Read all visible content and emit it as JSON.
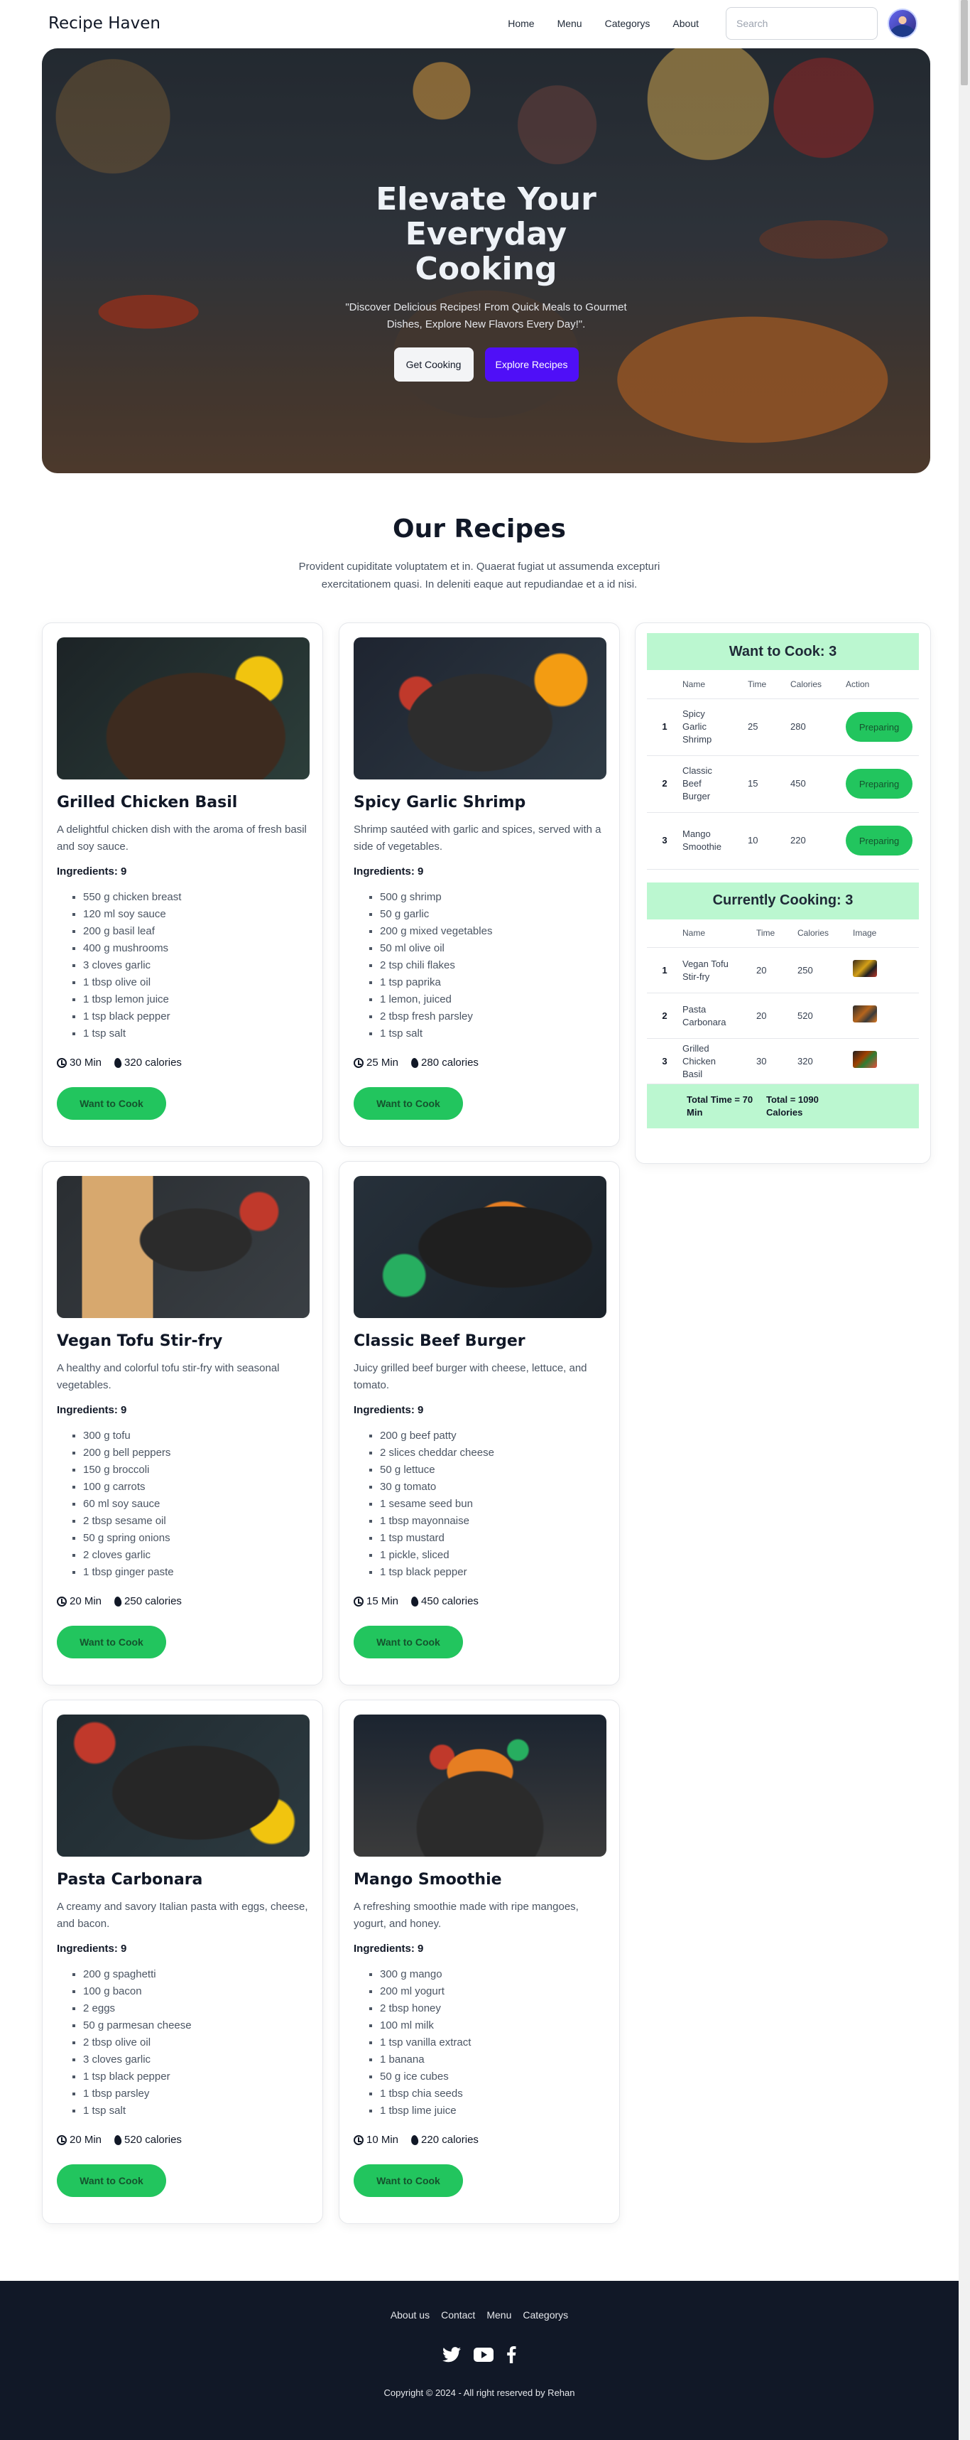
{
  "brand": "Recipe Haven",
  "nav": {
    "links": [
      "Home",
      "Menu",
      "Categorys",
      "About"
    ],
    "search_placeholder": "Search"
  },
  "hero": {
    "title": "Elevate Your Everyday Cooking",
    "subtitle": "\"Discover Delicious Recipes! From Quick Meals to Gourmet Dishes, Explore New Flavors Every Day!\".",
    "btn_get": "Get Cooking",
    "btn_explore": "Explore Recipes"
  },
  "section": {
    "title": "Our Recipes",
    "desc": "Provident cupiditate voluptatem et in. Quaerat fugiat ut assumenda excepturi exercitationem quasi. In deleniti eaque aut repudiandae et a id nisi."
  },
  "recipes": [
    {
      "title": "Grilled Chicken Basil",
      "desc": "A delightful chicken dish with the aroma of fresh basil and soy sauce.",
      "ing_label": "Ingredients: 9",
      "ingredients": [
        "550 g chicken breast",
        "120 ml soy sauce",
        "200 g basil leaf",
        "400 g mushrooms",
        "3 cloves garlic",
        "1 tbsp olive oil",
        "1 tbsp lemon juice",
        "1 tsp black pepper",
        "1 tsp salt"
      ],
      "time": "30 Min",
      "calories": "320 calories",
      "btn": "Want to Cook"
    },
    {
      "title": "Spicy Garlic Shrimp",
      "desc": "Shrimp sautéed with garlic and spices, served with a side of vegetables.",
      "ing_label": "Ingredients: 9",
      "ingredients": [
        "500 g shrimp",
        "50 g garlic",
        "200 g mixed vegetables",
        "50 ml olive oil",
        "2 tsp chili flakes",
        "1 tsp paprika",
        "1 lemon, juiced",
        "2 tbsp fresh parsley",
        "1 tsp salt"
      ],
      "time": "25 Min",
      "calories": "280 calories",
      "btn": "Want to Cook"
    },
    {
      "title": "Vegan Tofu Stir-fry",
      "desc": "A healthy and colorful tofu stir-fry with seasonal vegetables.",
      "ing_label": "Ingredients: 9",
      "ingredients": [
        "300 g tofu",
        "200 g bell peppers",
        "150 g broccoli",
        "100 g carrots",
        "60 ml soy sauce",
        "2 tbsp sesame oil",
        "50 g spring onions",
        "2 cloves garlic",
        "1 tbsp ginger paste"
      ],
      "time": "20 Min",
      "calories": "250 calories",
      "btn": "Want to Cook"
    },
    {
      "title": "Classic Beef Burger",
      "desc": "Juicy grilled beef burger with cheese, lettuce, and tomato.",
      "ing_label": "Ingredients: 9",
      "ingredients": [
        "200 g beef patty",
        "2 slices cheddar cheese",
        "50 g lettuce",
        "30 g tomato",
        "1 sesame seed bun",
        "1 tbsp mayonnaise",
        "1 tsp mustard",
        "1 pickle, sliced",
        "1 tsp black pepper"
      ],
      "time": "15 Min",
      "calories": "450 calories",
      "btn": "Want to Cook"
    },
    {
      "title": "Pasta Carbonara",
      "desc": "A creamy and savory Italian pasta with eggs, cheese, and bacon.",
      "ing_label": "Ingredients: 9",
      "ingredients": [
        "200 g spaghetti",
        "100 g bacon",
        "2 eggs",
        "50 g parmesan cheese",
        "2 tbsp olive oil",
        "3 cloves garlic",
        "1 tsp black pepper",
        "1 tbsp parsley",
        "1 tsp salt"
      ],
      "time": "20 Min",
      "calories": "520 calories",
      "btn": "Want to Cook"
    },
    {
      "title": "Mango Smoothie",
      "desc": "A refreshing smoothie made with ripe mangoes, yogurt, and honey.",
      "ing_label": "Ingredients: 9",
      "ingredients": [
        "300 g mango",
        "200 ml yogurt",
        "2 tbsp honey",
        "100 ml milk",
        "1 tsp vanilla extract",
        "1 banana",
        "50 g ice cubes",
        "1 tbsp chia seeds",
        "1 tbsp lime juice"
      ],
      "time": "10 Min",
      "calories": "220 calories",
      "btn": "Want to Cook"
    }
  ],
  "want": {
    "title": "Want to Cook: 3",
    "headers": [
      "Name",
      "Time",
      "Calories",
      "Action"
    ],
    "rows": [
      {
        "n": "1",
        "name": "Spicy Garlic Shrimp",
        "time": "25",
        "cal": "280",
        "action": "Preparing"
      },
      {
        "n": "2",
        "name": "Classic Beef Burger",
        "time": "15",
        "cal": "450",
        "action": "Preparing"
      },
      {
        "n": "3",
        "name": "Mango Smoothie",
        "time": "10",
        "cal": "220",
        "action": "Preparing"
      }
    ]
  },
  "cooking": {
    "title": "Currently Cooking: 3",
    "headers": [
      "Name",
      "Time",
      "Calories",
      "Image"
    ],
    "rows": [
      {
        "n": "1",
        "name": "Vegan Tofu Stir-fry",
        "time": "20",
        "cal": "250"
      },
      {
        "n": "2",
        "name": "Pasta Carbonara",
        "time": "20",
        "cal": "520"
      },
      {
        "n": "3",
        "name": "Grilled Chicken Basil",
        "time": "30",
        "cal": "320"
      }
    ],
    "total_time": "Total Time = 70 Min",
    "total_cal": "Total = 1090 Calories"
  },
  "footer": {
    "links": [
      "About us",
      "Contact",
      "Menu",
      "Categorys"
    ],
    "copyright": "Copyright © 2024 - All right reserved by Rehan"
  },
  "colors": {
    "accent": "#22c55e",
    "primary": "#4f0ff7",
    "panel": "#bbf7d0",
    "footer": "#111827"
  }
}
